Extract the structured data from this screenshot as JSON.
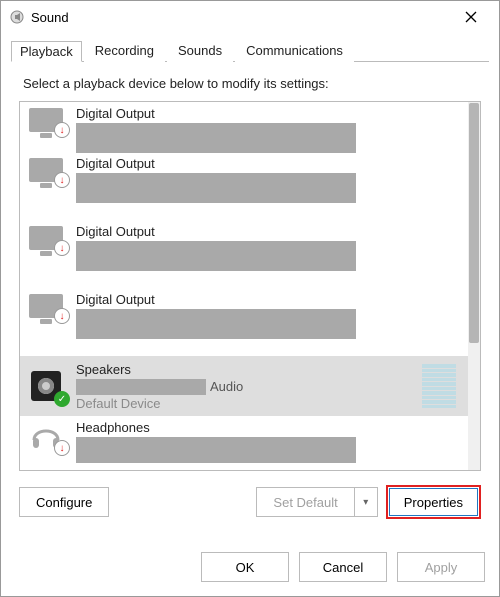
{
  "window": {
    "title": "Sound"
  },
  "tabs": {
    "playback": "Playback",
    "recording": "Recording",
    "sounds": "Sounds",
    "communications": "Communications",
    "active": "playback"
  },
  "instruction": "Select a playback device below to modify its settings:",
  "devices": [
    {
      "name": "Digital Output",
      "icon": "monitor",
      "badge": "down-arrow"
    },
    {
      "name": "Digital Output",
      "icon": "monitor",
      "badge": "down-arrow"
    },
    {
      "name": "Digital Output",
      "icon": "monitor",
      "badge": "down-arrow"
    },
    {
      "name": "Digital Output",
      "icon": "monitor",
      "badge": "down-arrow"
    },
    {
      "name": "Speakers",
      "sub_suffix": "Audio",
      "status": "Default Device",
      "icon": "speaker",
      "badge": "check",
      "selected": true,
      "meter": true
    },
    {
      "name": "Headphones",
      "icon": "headphones",
      "badge": "down-arrow"
    }
  ],
  "buttons": {
    "configure": "Configure",
    "set_default": "Set Default",
    "properties": "Properties",
    "ok": "OK",
    "cancel": "Cancel",
    "apply": "Apply"
  }
}
